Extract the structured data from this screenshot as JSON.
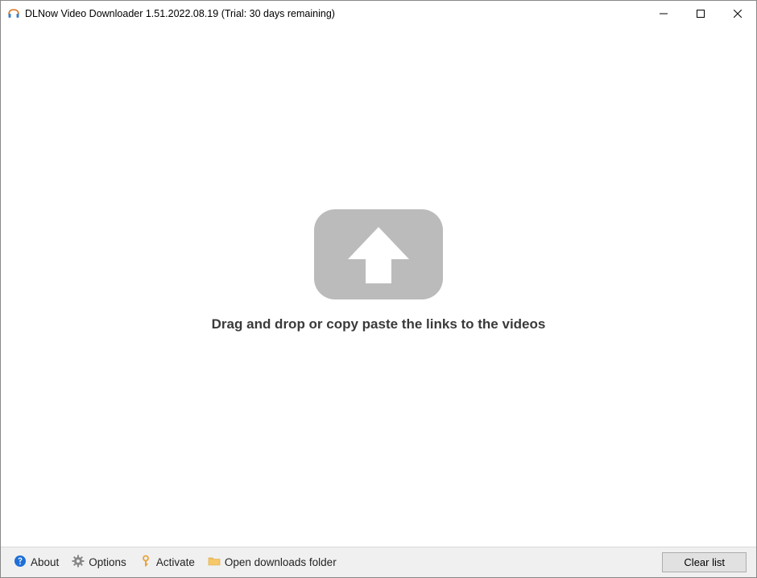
{
  "titlebar": {
    "title": "DLNow Video Downloader 1.51.2022.08.19 (Trial: 30 days remaining)"
  },
  "main": {
    "drop_text": "Drag and drop or copy paste the links to the videos"
  },
  "statusbar": {
    "about_label": "About",
    "options_label": "Options",
    "activate_label": "Activate",
    "open_folder_label": "Open downloads folder",
    "clear_list_label": "Clear list"
  },
  "icons": {
    "app": "headphones-icon",
    "about": "help-circle-icon",
    "options": "gear-icon",
    "activate": "key-icon",
    "folder": "folder-icon"
  },
  "colors": {
    "accent_blue": "#1e6fd6",
    "activate_yellow": "#e8a33d",
    "folder_yellow": "#f7c869",
    "drop_gray": "#bbbbbb"
  }
}
